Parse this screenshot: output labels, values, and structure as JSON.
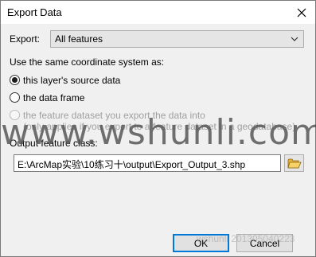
{
  "window": {
    "title": "Export Data"
  },
  "export": {
    "label": "Export:",
    "selected": "All features"
  },
  "coordinate_system": {
    "label": "Use the same coordinate system as:",
    "options": [
      {
        "label": "this layer's source data",
        "checked": true,
        "disabled": false
      },
      {
        "label": "the data frame",
        "checked": false,
        "disabled": false
      },
      {
        "label": "the feature dataset you export the data into",
        "note": "(only applies if you export to a feature dataset in a geodatabase)",
        "checked": false,
        "disabled": true
      }
    ]
  },
  "output": {
    "label": "Output feature class:",
    "value": "E:\\ArcMap实验\\10练习十\\output\\Export_Output_3.shp"
  },
  "buttons": {
    "ok": "OK",
    "cancel": "Cancel"
  },
  "watermark": {
    "main": "www.wshunli.com",
    "secondary": "wshunli 201305040223"
  },
  "colors": {
    "default_button_border": "#0078d7",
    "disabled_text": "#a0a0a0"
  },
  "icons": {
    "close": "close-icon",
    "dropdown": "chevron-down-icon",
    "browse": "open-folder-icon"
  }
}
